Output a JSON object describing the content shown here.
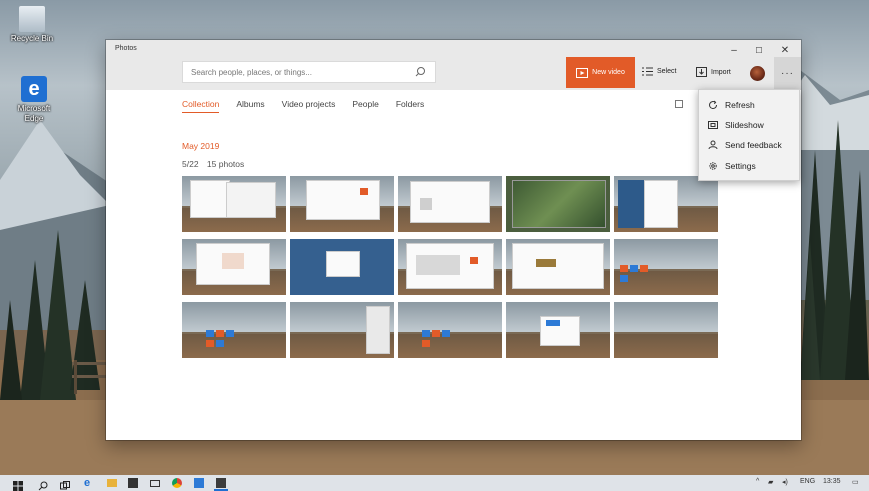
{
  "desktop": {
    "icons": [
      {
        "label": "Recycle Bin"
      },
      {
        "label": "Microsoft Edge"
      }
    ]
  },
  "window": {
    "app_name": "Photos",
    "controls": {
      "minimize": "–",
      "maximize": "☐",
      "close": "✕"
    }
  },
  "toolbar": {
    "search_placeholder": "Search people, places, or things...",
    "new_video": "New video",
    "select": "Select",
    "import": "Import",
    "more": "···"
  },
  "tabs": [
    {
      "label": "Collection",
      "active": true
    },
    {
      "label": "Albums",
      "active": false
    },
    {
      "label": "Video projects",
      "active": false
    },
    {
      "label": "People",
      "active": false
    },
    {
      "label": "Folders",
      "active": false
    }
  ],
  "collection": {
    "month": "May 2019",
    "date": "5/22",
    "count": "15 photos"
  },
  "menu": {
    "items": [
      {
        "label": "Refresh",
        "icon": "refresh-icon"
      },
      {
        "label": "Slideshow",
        "icon": "slideshow-icon"
      },
      {
        "label": "Send feedback",
        "icon": "feedback-icon"
      },
      {
        "label": "Settings",
        "icon": "gear-icon"
      }
    ]
  },
  "taskbar": {
    "language": "ENG",
    "time": "13:35"
  },
  "colors": {
    "accent": "#e25b28",
    "titlebar": "#e9e9e9",
    "menu": "#f2f2f2",
    "taskbar": "#dfe3e8"
  }
}
